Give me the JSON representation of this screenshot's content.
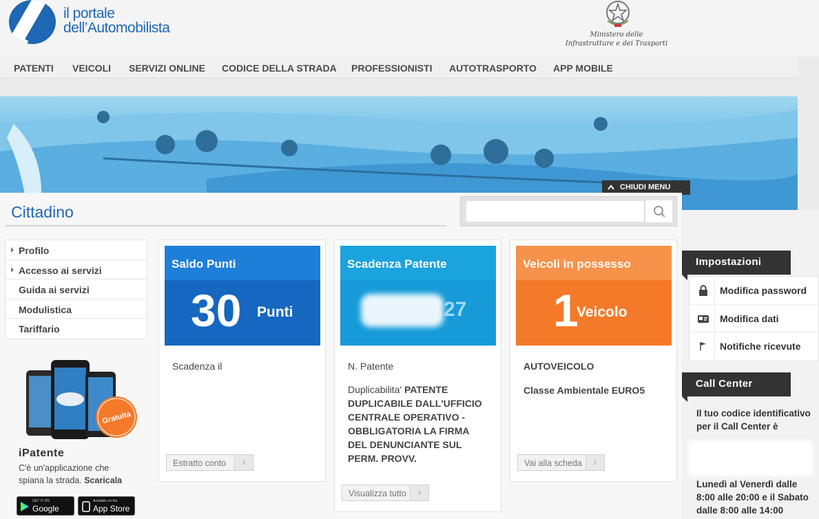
{
  "header": {
    "logo_line1": "il portale",
    "logo_line2": "dell’Automobilista",
    "ministry_line1": "Ministero delle",
    "ministry_line2": "Infrastrutture e dei Trasporti"
  },
  "nav": {
    "items": [
      "PATENTI",
      "VEICOLI",
      "SERVIZI ONLINE",
      "CODICE DELLA STRADA",
      "PROFESSIONISTI",
      "AUTOTRASPORTO",
      "APP MOBILE"
    ]
  },
  "banner": {
    "close_menu_label": "CHIUDI MENU"
  },
  "page": {
    "title": "Cittadino"
  },
  "search": {
    "placeholder": "",
    "value": ""
  },
  "sidebar": {
    "items": [
      {
        "label": "Profilo",
        "has_caret": true
      },
      {
        "label": "Accesso ai servizi",
        "has_caret": true
      },
      {
        "label": "Guida ai servizi",
        "has_caret": false
      },
      {
        "label": "Modulistica",
        "has_caret": false
      },
      {
        "label": "Tariffario",
        "has_caret": false
      }
    ]
  },
  "app_promo": {
    "badge": "Gratuita",
    "title": "iPatente",
    "desc_line1": "C'è un'applicazione che",
    "desc_line2": "spiana la strada.",
    "desc_link": "Scaricala",
    "google_small": "GET IT ON",
    "google_big": "Google play",
    "apple_small": "Available on the",
    "apple_big": "App Store"
  },
  "cards": [
    {
      "title": "Saldo Punti",
      "value": "30",
      "unit": "Punti",
      "text1": "Scadenza il",
      "button": "Estratto conto",
      "head_color": "#1e7fd8",
      "body_color": "#1567bf"
    },
    {
      "title": "Scadenza Patente",
      "value_hint": "27",
      "text1": "N. Patente",
      "text2_label": "Duplicabilita'",
      "text2_bold": "PATENTE",
      "text3": "DUPLICABILE DALL'UFFICIO",
      "text4": "CENTRALE OPERATIVO -",
      "text5": "OBBLIGATORIA LA FIRMA",
      "text6": "DEL DENUNCIANTE SUL",
      "text7": "PERM. PROVV.",
      "button": "Visualizza tutto",
      "head_color": "#1aa3dd",
      "body_color": "#169bd8"
    },
    {
      "title": "Veicoli in possesso",
      "value": "1",
      "unit": "Veicolo",
      "text1": "AUTOVEICOLO",
      "text2": "Classe Ambientale EURO5",
      "button": "Vai alla scheda",
      "head_color": "#f7924a",
      "body_color": "#f47a2a"
    }
  ],
  "settings": {
    "title": "Impostazioni",
    "items": [
      {
        "label": "Modifica password",
        "icon": "lock-icon"
      },
      {
        "label": "Modifica dati",
        "icon": "id-card-icon"
      },
      {
        "label": "Notifiche ricevute",
        "icon": "flag-icon"
      }
    ]
  },
  "call_center": {
    "title": "Call Center",
    "line1": "Il tuo codice identificativo",
    "line2": "per il Call Center è",
    "hours1": "Lunedì al Venerdì dalle",
    "hours2": "8:00 alle 20:00 e il Sabato",
    "hours3": "dalle 8:00 alle 14:00"
  }
}
